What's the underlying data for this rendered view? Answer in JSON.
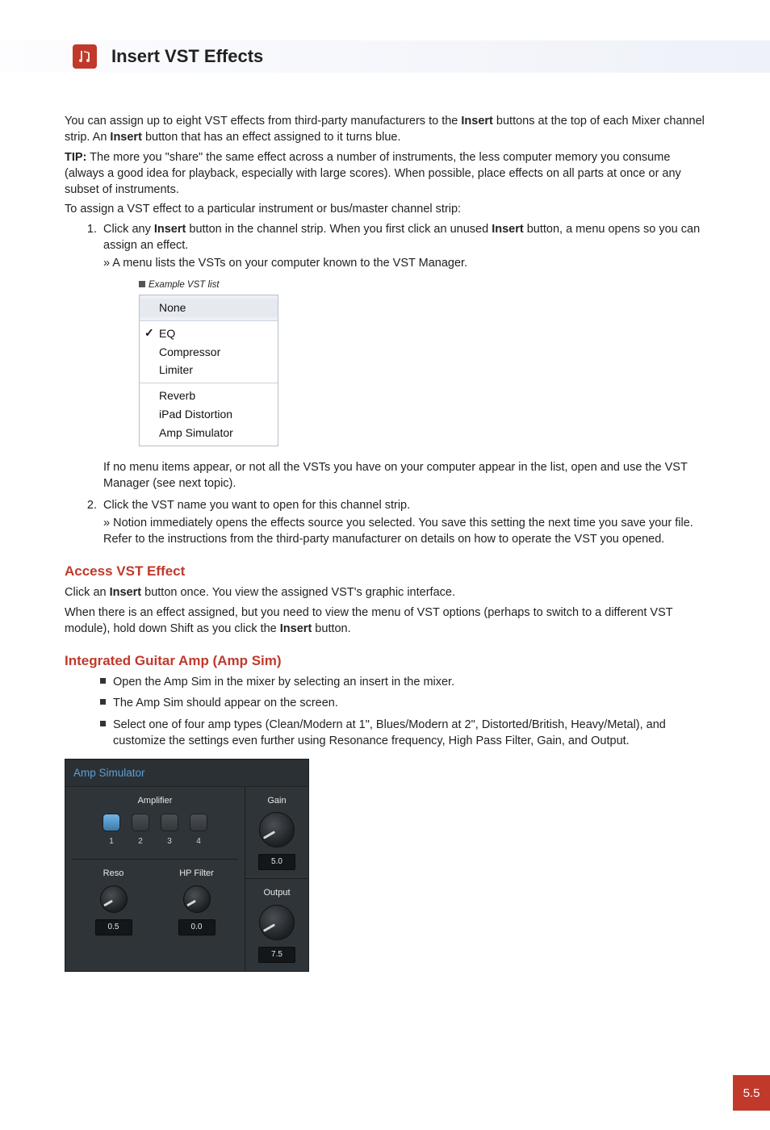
{
  "header": {
    "title": "Insert VST Effects",
    "icon_name": "app-icon"
  },
  "intro": {
    "p1_a": "You can assign up to eight VST effects from third-party manufacturers to the ",
    "p1_b": "Insert",
    "p1_c": " buttons at the top of each Mixer channel strip. An ",
    "p1_d": "Insert",
    "p1_e": " button that has an effect assigned to it turns blue.",
    "tip_label": "TIP:",
    "tip_text": " The more you \"share\" the same effect across a number of instruments, the less computer memory you consume (always a good idea for playback, especially with large scores). When possible, place effects on all parts at once or any subset of instruments.",
    "p3": "To assign a VST effect to a particular instrument or bus/master channel strip:"
  },
  "steps": {
    "s1_a": "Click any ",
    "s1_b": "Insert",
    "s1_c": " button in the channel strip. When you first click an unused ",
    "s1_d": "Insert",
    "s1_e": " button, a menu opens so you can assign an effect.",
    "s1_sub": "» A menu lists the VSTs on your computer known to the VST Manager.",
    "s1_after": "If no menu items appear, or not all the VSTs you have on your computer appear in the list, open and use the VST Manager (see next topic).",
    "s2_a": "Click the VST name you want to open for this channel strip.",
    "s2_sub": "» Notion immediately opens the effects source you selected. You save this setting the next time you save your file. Refer to the instructions from the third-party manufacturer on details on how to operate the VST you opened."
  },
  "vst_menu": {
    "caption": "Example VST list",
    "groups": [
      {
        "items": [
          {
            "label": "None",
            "checked": false
          }
        ]
      },
      {
        "items": [
          {
            "label": "EQ",
            "checked": true
          },
          {
            "label": "Compressor",
            "checked": false
          },
          {
            "label": "Limiter",
            "checked": false
          }
        ]
      },
      {
        "items": [
          {
            "label": "Reverb",
            "checked": false
          },
          {
            "label": "iPad Distortion",
            "checked": false
          },
          {
            "label": "Amp Simulator",
            "checked": false
          }
        ]
      }
    ]
  },
  "access": {
    "heading": "Access VST Effect",
    "p1_a": "Click an ",
    "p1_b": "Insert",
    "p1_c": " button once. You view the assigned VST's graphic interface.",
    "p2_a": "When there is an effect assigned, but you need to view the menu of VST options (perhaps to switch to a different VST module), hold down Shift as you click the ",
    "p2_b": "Insert",
    "p2_c": " button."
  },
  "ampsim_section": {
    "heading": "Integrated Guitar Amp (Amp Sim)",
    "bullets": [
      "Open the Amp Sim in the mixer by selecting an insert in the mixer.",
      "The Amp Sim should appear on the screen.",
      "Select one of four amp types (Clean/Modern at 1\", Blues/Modern at 2\", Distorted/British, Heavy/Metal), and customize the settings even further using Resonance frequency, High Pass Filter, Gain, and Output."
    ]
  },
  "amp_panel": {
    "title": "Amp Simulator",
    "amplifier_label": "Amplifier",
    "buttons": [
      {
        "label": "1",
        "active": true
      },
      {
        "label": "2",
        "active": false
      },
      {
        "label": "3",
        "active": false
      },
      {
        "label": "4",
        "active": false
      }
    ],
    "reso": {
      "label": "Reso",
      "value": "0.5"
    },
    "hpfilter": {
      "label": "HP Filter",
      "value": "0.0"
    },
    "gain": {
      "label": "Gain",
      "value": "5.0"
    },
    "output": {
      "label": "Output",
      "value": "7.5"
    }
  },
  "page_number": "5.5"
}
